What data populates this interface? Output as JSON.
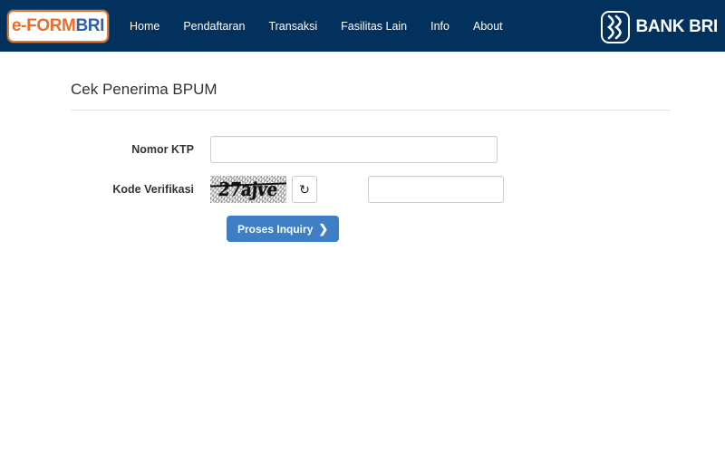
{
  "navbar": {
    "logo": {
      "eform": "e-FORM",
      "bri": "BRI",
      "icon": "eform-bri-logo"
    },
    "links": [
      {
        "label": "Home"
      },
      {
        "label": "Pendaftaran"
      },
      {
        "label": "Transaksi"
      },
      {
        "label": "Fasilitas Lain"
      },
      {
        "label": "Info"
      },
      {
        "label": "About"
      }
    ],
    "bank": {
      "name": "BANK BRI",
      "icon": "bank-bri-mark"
    },
    "colors": {
      "background": "#01315c",
      "logo_orange": "#e8702a",
      "logo_blue": "#2f61a4"
    }
  },
  "main": {
    "title": "Cek Penerima BPUM",
    "form": {
      "ktp": {
        "label": "Nomor KTP",
        "value": "",
        "placeholder": ""
      },
      "captcha": {
        "label": "Kode Verifikasi",
        "image_text": "27ajve",
        "refresh_icon": "refresh-icon",
        "refresh_glyph": "↻",
        "value": "",
        "placeholder": ""
      },
      "submit": {
        "label": "Proses Inquiry",
        "chevron": "❯",
        "color": "#3d7ec4"
      }
    }
  }
}
